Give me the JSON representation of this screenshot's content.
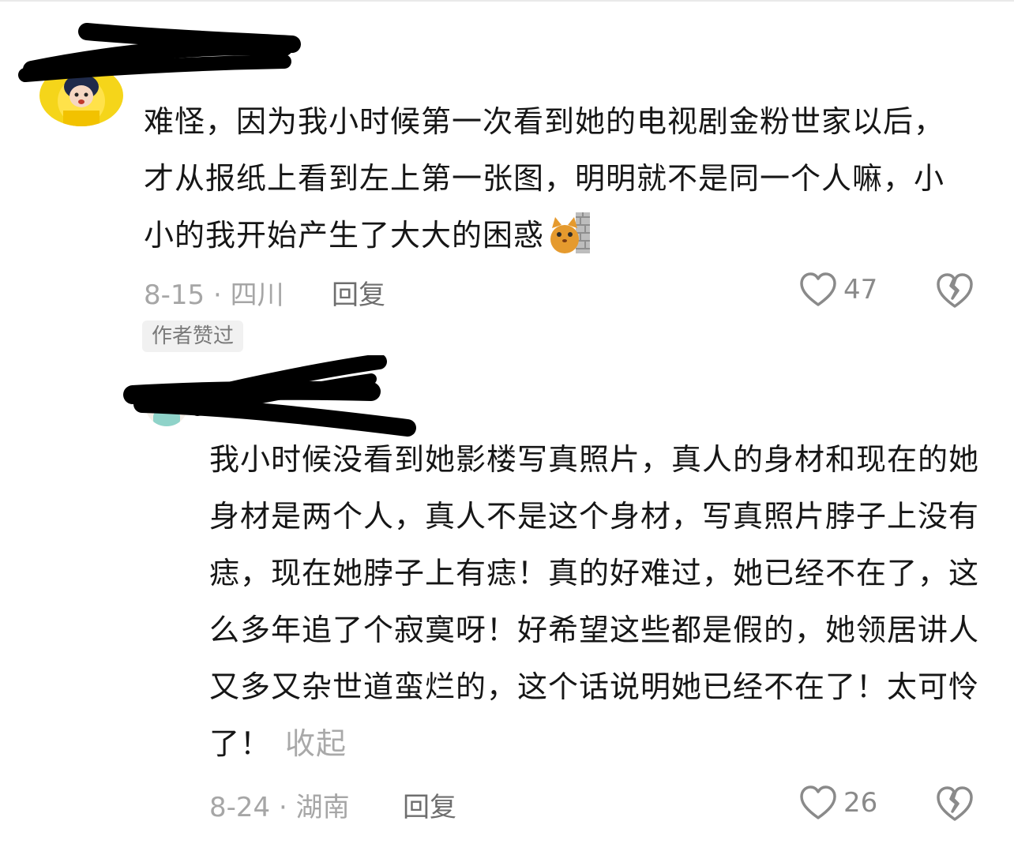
{
  "comments": [
    {
      "text": "难怪，因为我小时候第一次看到她的电视剧金粉世家以后，才从报纸上看到左上第一张图，明明就不是同一个人嘛，小小的我开始产生了大大的困惑",
      "emoji": "cat-behind-wall-icon",
      "date_location": "8-15 · 四川",
      "reply_label": "回复",
      "like_count": "47",
      "badge": "作者赞过"
    },
    {
      "text": "我小时候没看到她影楼写真照片，真人的身材和现在的她身材是两个人，真人不是这个身材，写真照片脖子上没有痣，现在她脖子上有痣！真的好难过，她已经不在了，这么多年追了个寂寞呀！好希望这些都是假的，她领居讲人又多又杂世道蛮烂的，这个话说明她已经不在了！太可怜了！",
      "collapse_label": "收起",
      "date_location": "8-24 · 湖南",
      "reply_label": "回复",
      "like_count": "26"
    }
  ],
  "colors": {
    "text": "#161616",
    "meta": "#a6a6a6",
    "redaction": "#000000"
  }
}
